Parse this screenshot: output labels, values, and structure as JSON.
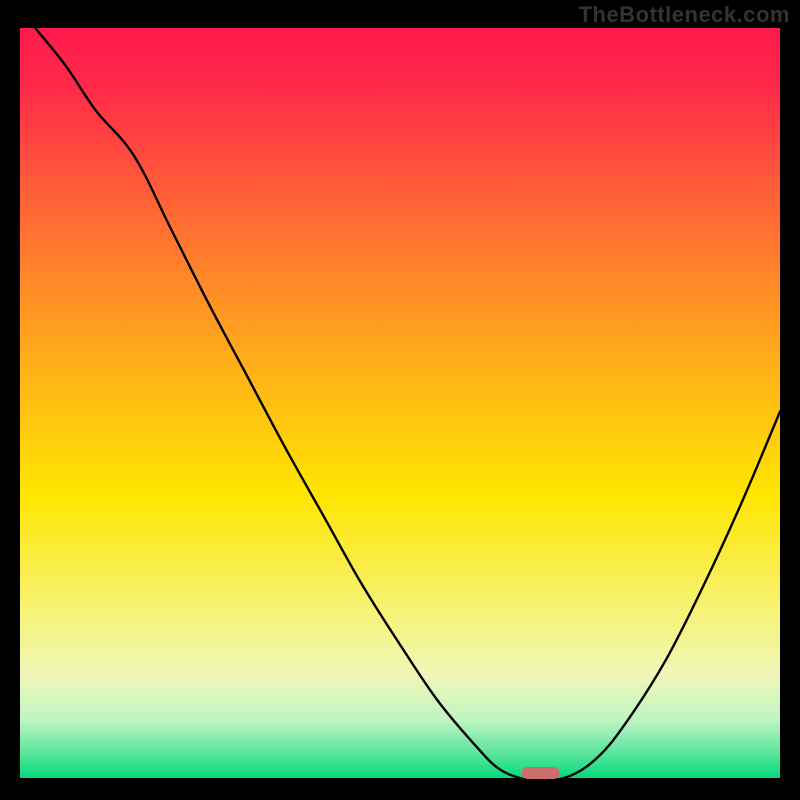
{
  "watermark": "TheBottleneck.com",
  "colors": {
    "background_black": "#000000",
    "curve_stroke": "#000000",
    "marker_fill": "#cc6e6e",
    "gradient_top": "#ff1a4d",
    "gradient_bottom": "#00d978"
  },
  "chart_data": {
    "type": "line",
    "title": "",
    "xlabel": "",
    "ylabel": "",
    "xlim": [
      0,
      100
    ],
    "ylim": [
      0,
      100
    ],
    "x": [
      2,
      6,
      10,
      15,
      20,
      25,
      30,
      35,
      40,
      45,
      50,
      55,
      60,
      63,
      66,
      68,
      72,
      76,
      80,
      85,
      90,
      95,
      100
    ],
    "values": [
      100,
      95,
      89,
      83,
      73,
      63,
      53.5,
      44,
      35,
      26,
      18,
      10.5,
      4.5,
      1.5,
      0.2,
      0,
      0.4,
      3,
      8,
      16,
      26,
      37,
      49
    ],
    "optimal_x": 68,
    "marker": {
      "x_start": 66,
      "x_end": 71,
      "thickness_pct": 1.6
    }
  }
}
